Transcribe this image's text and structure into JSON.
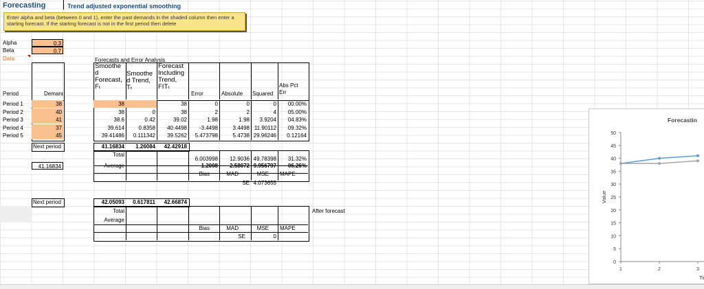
{
  "header": {
    "title": "Forecasting",
    "subtitle": "Trend adjusted exponential smoothing"
  },
  "note": "Enter alpha and beta (between 0 and 1), enter the past demands in the shaded column then enter a starting forecast. If the starting forecast is not in the first period then delete",
  "params": {
    "alpha_label": "Alpha",
    "alpha": "0.3",
    "beta_label": "Beta",
    "beta": "0.7",
    "data_label": "Data"
  },
  "section_title": "Forecasts and Error Analysis",
  "columns": {
    "period": "Period",
    "demand": "Demand",
    "smoothed": [
      "Smoothe",
      "d",
      "Forecast,",
      "Fₜ"
    ],
    "trend": [
      "Smoothe",
      "d Trend,",
      "Tₜ"
    ],
    "fit": [
      "Forecast",
      "Including",
      "Trend,",
      "FITₜ"
    ],
    "error": "Error",
    "absolute": "Absolute",
    "squared": "Squared",
    "abspct": [
      "Abs Pct",
      "Err"
    ]
  },
  "rows": [
    {
      "period": "Period 1",
      "demand": "38",
      "smoothed": "38",
      "trend": "",
      "fit": "38",
      "error": "0",
      "absolute": "0",
      "squared": "0",
      "abspct": "00.00%"
    },
    {
      "period": "Period 2",
      "demand": "40",
      "smoothed": "38",
      "trend": "0",
      "fit": "38",
      "error": "2",
      "absolute": "2",
      "squared": "4",
      "abspct": "05.00%"
    },
    {
      "period": "Period 3",
      "demand": "41",
      "smoothed": "38.6",
      "trend": "0.42",
      "fit": "39.02",
      "error": "1.98",
      "absolute": "1.98",
      "squared": "3.9204",
      "abspct": "04.83%"
    },
    {
      "period": "Period 4",
      "demand": "37",
      "smoothed": "39.614",
      "trend": "0.8358",
      "fit": "40.4498",
      "error": "-3.4498",
      "absolute": "3.4498",
      "squared": "11.90112",
      "abspct": "09.32%"
    },
    {
      "period": "Period 5",
      "demand": "45",
      "smoothed": "39.41486",
      "trend": "0.111342",
      "fit": "39.5262",
      "error": "5.473798",
      "absolute": "5.4738",
      "squared": "29.96246",
      "abspct": "0.12164"
    }
  ],
  "next_period": {
    "label": "Next period",
    "smoothed": "41.16834",
    "trend": "1.26084",
    "fit": "42.42918"
  },
  "next_value": "41.16834",
  "totals": {
    "label": "Total",
    "error": "6.003998",
    "absolute": "12.9036",
    "squared": "49.78398",
    "abspct": "31.32%"
  },
  "averages": {
    "label": "Average",
    "error": "1.2008",
    "absolute": "2.58072",
    "squared": "9.956797",
    "abspct": "06.26%"
  },
  "stat_labels": {
    "bias": "Bias",
    "mad": "MAD",
    "mse": "MSE",
    "mape": "MAPE",
    "se": "SE",
    "se_value": "4.073655"
  },
  "after": {
    "next_label": "Next period",
    "smoothed": "42.05093",
    "trend": "0.617811",
    "fit": "42.66874",
    "total": "Total",
    "average": "Average",
    "note": "After forecast",
    "bias": "Bias",
    "mad": "MAD",
    "mse": "MSE",
    "mape": "MAPE",
    "se": "SE",
    "se_value": "0"
  },
  "chart": {
    "title": "Forecastin",
    "ylabel": "Value",
    "xlabel": "Tim",
    "yticks": [
      "0",
      "5",
      "10",
      "15",
      "20",
      "25",
      "30",
      "35",
      "40",
      "45",
      "50"
    ],
    "xticks": [
      "1",
      "2",
      "3"
    ]
  },
  "chart_data": {
    "type": "line",
    "title": "Forecastin",
    "xlabel": "Tim",
    "ylabel": "Value",
    "ylim": [
      0,
      50
    ],
    "x": [
      1,
      2,
      3
    ],
    "series": [
      {
        "values": [
          38,
          40,
          41
        ],
        "color": "#5b9bd5"
      },
      {
        "values": [
          38,
          38,
          39.02
        ],
        "color": "#a5a5a5"
      }
    ]
  },
  "colors": {
    "input_fill": "#fac090",
    "title": "#1f4e79",
    "note_fill": "#fbe58a"
  }
}
